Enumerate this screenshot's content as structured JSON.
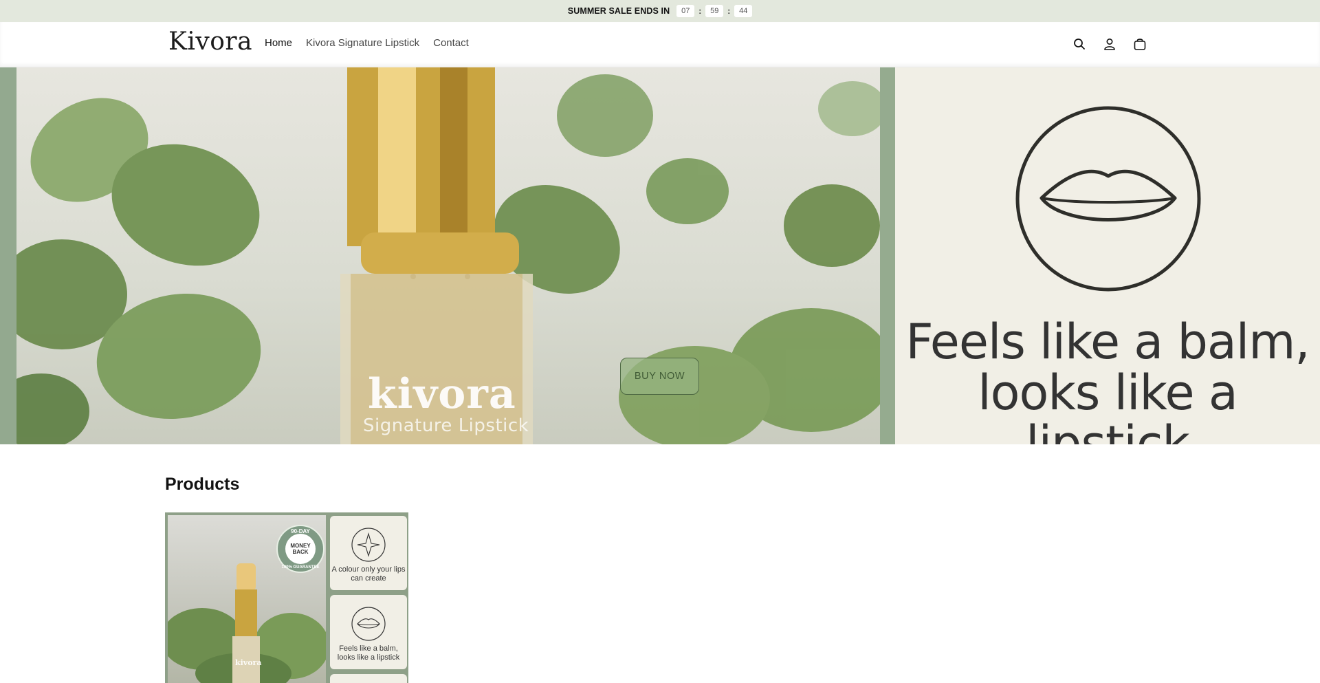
{
  "announcement": {
    "text": "SUMMER SALE ENDS IN",
    "hours": "07",
    "minutes": "59",
    "seconds": "44",
    "separator": ":"
  },
  "header": {
    "logo": "Kivora",
    "nav": [
      {
        "label": "Home",
        "active": true
      },
      {
        "label": "Kivora Signature Lipstick",
        "active": false
      },
      {
        "label": "Contact",
        "active": false
      }
    ],
    "icons": [
      "search-icon",
      "account-icon",
      "cart-icon"
    ]
  },
  "hero": {
    "image_brand": "kivora",
    "image_product": "Signature Lipstick",
    "tagline_line1": "Feels like a balm,",
    "tagline_line2": "looks like a lipstick",
    "button_label": "BUY NOW",
    "icon": "lips-icon"
  },
  "products": {
    "title": "Products",
    "items": [
      {
        "badge_top": "90-DAY",
        "badge_line1": "MONEY",
        "badge_line2": "BACK",
        "badge_bottom": "100% GUARANTEE",
        "image_brand": "kivora",
        "panel1_text": "A colour only your lips can create",
        "panel2_text": "Feels like a balm, looks like a lipstick",
        "panel1_icon": "sparkle-icon",
        "panel2_icon": "lips-icon"
      }
    ]
  },
  "colors": {
    "announcement_bg": "#e3e8dd",
    "accent_green": "#8ea088",
    "cream": "#f1efe6",
    "gold": "#c9a440"
  }
}
